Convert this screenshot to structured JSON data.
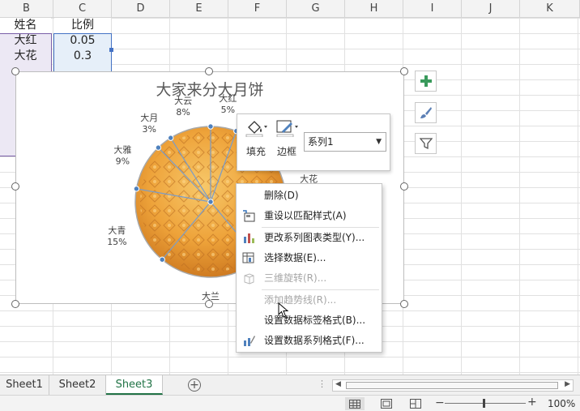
{
  "sheet": {
    "columns": [
      "B",
      "C",
      "D",
      "E",
      "F",
      "G",
      "H",
      "I",
      "J",
      "K"
    ],
    "header_row": {
      "b": "姓名",
      "c": "比例"
    },
    "rows": [
      {
        "b": "大红",
        "c": "0.05"
      },
      {
        "b": "大花",
        "c": "0.3"
      }
    ]
  },
  "chart": {
    "title": "大家来分大月饼",
    "accent": "#4f81bd",
    "slices": [
      {
        "name": "大红",
        "pct": "5%",
        "value": 0.05
      },
      {
        "name": "大花",
        "pct": "30%",
        "value": 0.3
      },
      {
        "name": "大兰",
        "pct": "20%",
        "value": 0.2
      },
      {
        "name": "大青",
        "pct": "15%",
        "value": 0.15
      },
      {
        "name": "大雅",
        "pct": "9%",
        "value": 0.09
      },
      {
        "name": "大月",
        "pct": "3%",
        "value": 0.03
      },
      {
        "name": "大云",
        "pct": "8%",
        "value": 0.08
      }
    ]
  },
  "side_buttons": [
    "chart-elements-plus-icon",
    "chart-styles-brush-icon",
    "chart-filter-icon"
  ],
  "minibar": {
    "fill_label": "填充",
    "outline_label": "边框",
    "series_value": "系列1"
  },
  "context_menu": [
    {
      "label": "删除(D)",
      "disabled": false,
      "icon": "none"
    },
    {
      "label": "重设以匹配样式(A)",
      "disabled": false,
      "icon": "reset-style-icon"
    },
    {
      "label": "更改系列图表类型(Y)...",
      "disabled": false,
      "icon": "change-chart-type-icon"
    },
    {
      "label": "选择数据(E)...",
      "disabled": false,
      "icon": "select-data-icon"
    },
    {
      "label": "三维旋转(R)...",
      "disabled": true,
      "icon": "3d-rotation-icon"
    },
    {
      "label": "添加趋势线(R)...",
      "disabled": true,
      "icon": "none"
    },
    {
      "label": "设置数据标签格式(B)...",
      "disabled": false,
      "icon": "none"
    },
    {
      "label": "设置数据系列格式(F)...",
      "disabled": false,
      "icon": "format-series-icon"
    }
  ],
  "tabs": [
    "Sheet1",
    "Sheet2",
    "Sheet3"
  ],
  "active_tab": "Sheet3",
  "status": {
    "zoom": "100%"
  }
}
